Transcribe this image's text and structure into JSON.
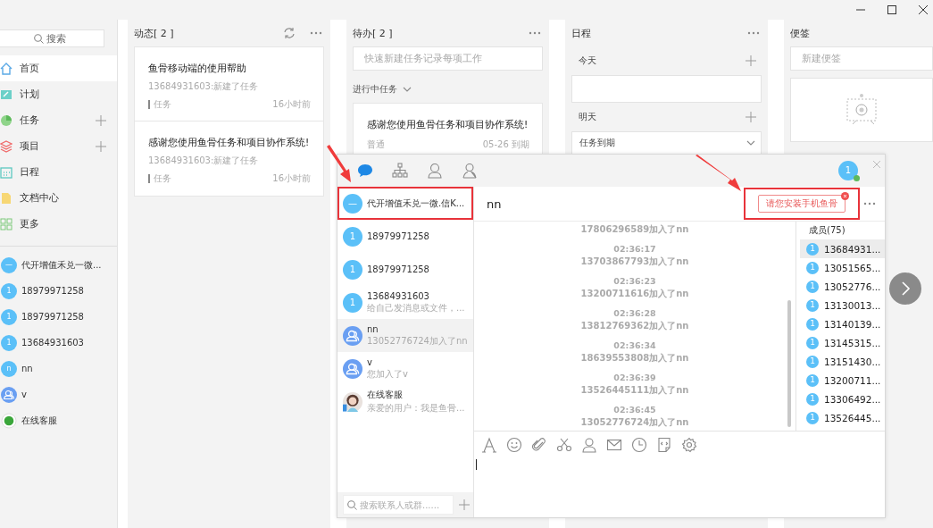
{
  "sidebar": {
    "search": {
      "placeholder": "搜索"
    },
    "nav": [
      {
        "kind": "home",
        "label": "首页",
        "selected": true,
        "add_button": false
      },
      {
        "kind": "plan",
        "label": "计划",
        "selected": false,
        "add_button": false
      },
      {
        "kind": "task",
        "label": "任务",
        "selected": false,
        "add_button": true
      },
      {
        "kind": "project",
        "label": "项目",
        "selected": false,
        "add_button": true
      },
      {
        "kind": "schedule",
        "label": "日程",
        "selected": false,
        "add_button": false
      },
      {
        "kind": "docs",
        "label": "文档中心",
        "selected": false,
        "add_button": false
      },
      {
        "kind": "more",
        "label": "更多",
        "selected": false,
        "add_button": false
      }
    ],
    "chats": [
      {
        "kind": "letter",
        "avatar_text": "—",
        "name": "代开增值禾兑一微..."
      },
      {
        "kind": "letter",
        "avatar_text": "1",
        "name": "18979971258"
      },
      {
        "kind": "letter",
        "avatar_text": "1",
        "name": "18979971258"
      },
      {
        "kind": "letter",
        "avatar_text": "1",
        "name": "13684931603"
      },
      {
        "kind": "letter",
        "avatar_text": "n",
        "name": "nn"
      },
      {
        "kind": "group",
        "name": "v"
      },
      {
        "kind": "service",
        "name": "在线客服"
      }
    ]
  },
  "feed": {
    "title": "动态[ 2 ]",
    "cards": [
      {
        "title": "鱼骨移动端的使用帮助",
        "subtitle": "13684931603:新建了任务",
        "tag": "任务",
        "time": "16小时前"
      },
      {
        "title": "感谢您使用鱼骨任务和项目协作系统!",
        "subtitle": "13684931603:新建了任务",
        "tag": "任务",
        "time": "16小时前"
      }
    ]
  },
  "todo": {
    "title": "待办[ 2 ]",
    "quick_add": {
      "placeholder": "快速新建任务记录每项工作"
    },
    "section": "进行中任务",
    "cards": [
      {
        "title": "感谢您使用鱼骨任务和项目协作系统!",
        "priority": "普通",
        "due": "05-26 到期"
      }
    ]
  },
  "schedule": {
    "title": "日程",
    "days": [
      {
        "label": "今天",
        "kind": "empty"
      },
      {
        "label": "明天",
        "kind": "dropdown",
        "value": "任务到期"
      }
    ]
  },
  "notes": {
    "title": "便签",
    "new_note": {
      "placeholder": "新建便签"
    }
  },
  "chat": {
    "tabs": [
      {
        "kind": "chat",
        "selected": true
      },
      {
        "kind": "org",
        "selected": false
      },
      {
        "kind": "contact",
        "selected": false
      },
      {
        "kind": "contact-alt",
        "selected": false
      }
    ],
    "user": {
      "avatar_text": "1",
      "online": true
    },
    "conversations": [
      {
        "kind": "letter",
        "avatar_text": "—",
        "name": "代开增值禾兑一微.信K...",
        "selected": false,
        "highlight": true
      },
      {
        "kind": "letter",
        "avatar_text": "1",
        "name": "18979971258",
        "selected": false,
        "highlight": false
      },
      {
        "kind": "letter",
        "avatar_text": "1",
        "name": "18979971258",
        "selected": false,
        "highlight": false
      },
      {
        "kind": "letter",
        "avatar_text": "1",
        "name": "13684931603",
        "preview": "给自己发消息或文件，...",
        "selected": false,
        "highlight": false
      },
      {
        "kind": "group",
        "name": "nn",
        "preview": "13052776724加入了nn",
        "selected": true,
        "highlight": false
      },
      {
        "kind": "group",
        "name": "v",
        "preview": "您加入了v",
        "selected": false,
        "highlight": false
      },
      {
        "kind": "person",
        "name": "在线客服",
        "preview": "亲爱的用户：我是鱼骨...",
        "selected": false,
        "highlight": false
      }
    ],
    "search": {
      "placeholder": "搜索联系人或群......"
    },
    "title": "nn",
    "notice": {
      "text": "请您安装手机鱼骨",
      "highlight": true
    },
    "messages": [
      {
        "text": "17806296589加入了nn"
      },
      {
        "time": "02:36:17",
        "text": "13703867793加入了nn"
      },
      {
        "time": "02:36:23",
        "text": "13200711616加入了nn"
      },
      {
        "time": "02:36:28",
        "text": "13812769362加入了nn"
      },
      {
        "time": "02:36:34",
        "text": "18639553808加入了nn"
      },
      {
        "time": "02:36:39",
        "text": "13526445111加入了nn"
      },
      {
        "time": "02:36:45",
        "text": "13052776724加入了nn"
      }
    ],
    "members_title": "成员(75)",
    "members": [
      {
        "avatar_text": "1",
        "name": "13684931...",
        "selected": true
      },
      {
        "avatar_text": "1",
        "name": "13051565...",
        "selected": false
      },
      {
        "avatar_text": "1",
        "name": "13052776...",
        "selected": false
      },
      {
        "avatar_text": "1",
        "name": "13130013...",
        "selected": false
      },
      {
        "avatar_text": "1",
        "name": "13140139...",
        "selected": false
      },
      {
        "avatar_text": "1",
        "name": "13145315...",
        "selected": false
      },
      {
        "avatar_text": "1",
        "name": "13151430...",
        "selected": false
      },
      {
        "avatar_text": "1",
        "name": "13200711...",
        "selected": false
      },
      {
        "avatar_text": "1",
        "name": "13306492...",
        "selected": false
      },
      {
        "avatar_text": "1",
        "name": "13526445...",
        "selected": false
      }
    ],
    "toolbar": [
      {
        "kind": "font"
      },
      {
        "kind": "emoji"
      },
      {
        "kind": "attach"
      },
      {
        "kind": "cut"
      },
      {
        "kind": "contact"
      },
      {
        "kind": "mail"
      },
      {
        "kind": "clock"
      },
      {
        "kind": "code"
      },
      {
        "kind": "settings"
      }
    ]
  }
}
